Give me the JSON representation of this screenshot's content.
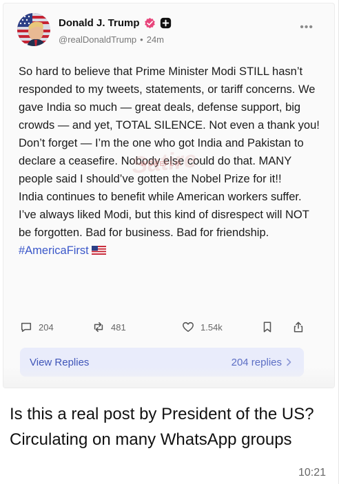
{
  "post": {
    "author": {
      "display_name": "Donald J. Trump",
      "handle": "@realDonaldTrump",
      "separator": "•",
      "time_ago": "24m",
      "avatar_icon": "flag-portrait-avatar",
      "verified_icon": "verified-badge-icon",
      "verified_color": "#e8467c"
    },
    "paragraphs": [
      "So hard to believe that Prime Minister Modi STILL hasn’t responded to my tweets, statements, or tariff concerns. We gave India so much — great deals, defense support, big crowds — and yet, TOTAL SILENCE. Not even a thank you!",
      "Don’t forget — I’m the one who got India and Pakistan to declare a ceasefire. Nobody else could do that. MANY people said I should’ve gotten the Nobel Prize for it!!",
      "India continues to benefit while American workers suffer. I’ve always liked Modi, but this kind of disrespect will NOT be forgotten. Bad for business. Bad for friendship."
    ],
    "hashtag": "#AmericaFirst",
    "hashtag_color": "#3a57c9",
    "watermark": {
      "main": "Satire",
      "sub": "WOKEFLIX"
    },
    "actions": {
      "replies": "204",
      "reposts": "481",
      "likes": "1.54k"
    },
    "view_replies_label": "View Replies",
    "replies_count_label": "204 replies",
    "accent_bar_color": "#e9ecfb"
  },
  "message": {
    "caption": "Is this a real post by President of the US? Circulating on many WhatsApp groups",
    "time": "10:21"
  }
}
